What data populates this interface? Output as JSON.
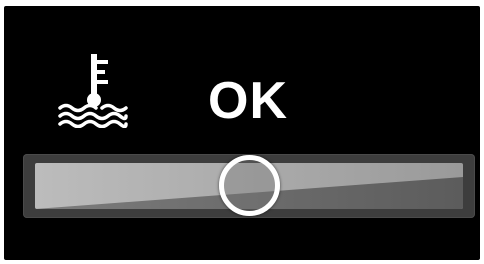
{
  "coolant": {
    "icon": "coolant-temperature-icon",
    "status": "OK",
    "gauge_level": 0.5
  },
  "colors": {
    "background": "#000000",
    "text": "#ffffff",
    "track": "#3d3d3d",
    "bar_light": "#b2b2b2",
    "bar_dark": "#666666"
  }
}
